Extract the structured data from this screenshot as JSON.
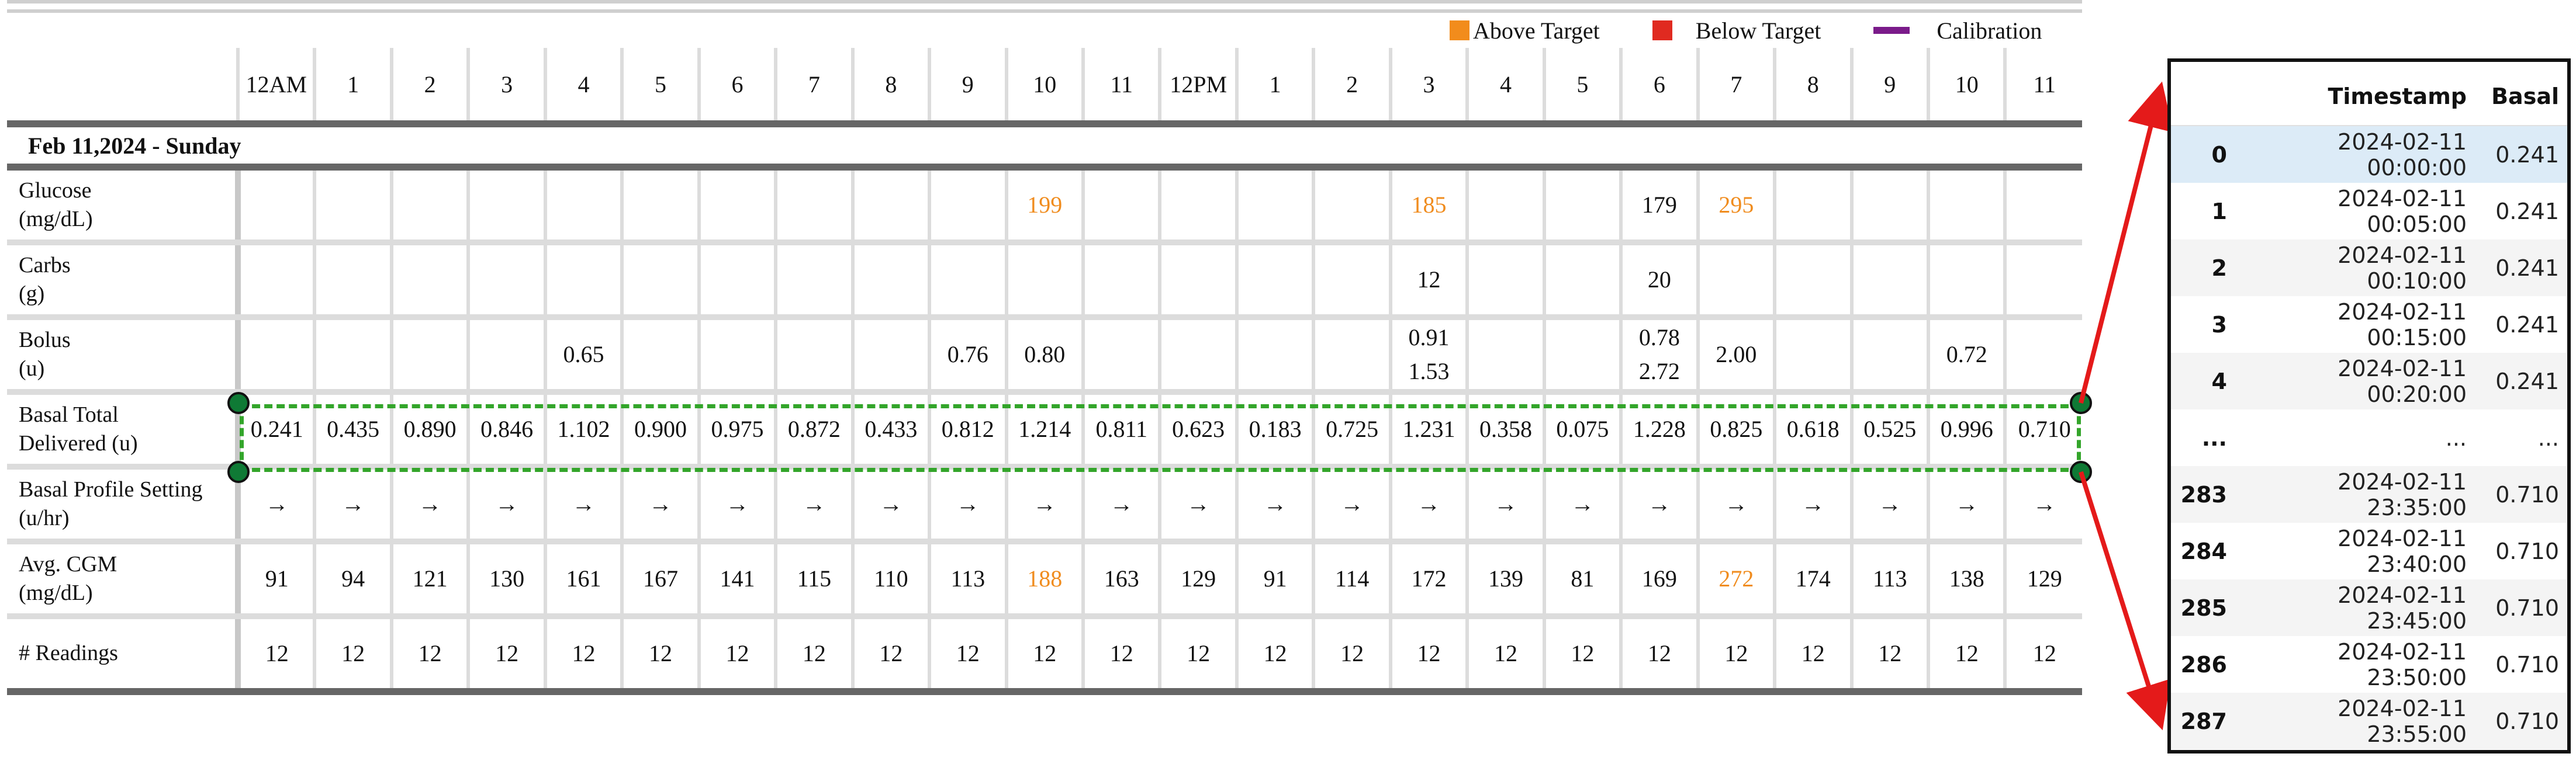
{
  "legend": [
    {
      "label": "Above Target",
      "color": "#f28c1c",
      "shape": "square"
    },
    {
      "label": "Below Target",
      "color": "#e02a20",
      "shape": "square"
    },
    {
      "label": "Calibration",
      "color": "#7b1b8a",
      "shape": "line"
    }
  ],
  "report": {
    "hours": [
      "12AM",
      "1",
      "2",
      "3",
      "4",
      "5",
      "6",
      "7",
      "8",
      "9",
      "10",
      "11",
      "12PM",
      "1",
      "2",
      "3",
      "4",
      "5",
      "6",
      "7",
      "8",
      "9",
      "10",
      "11"
    ],
    "date_label": "Feb 11,2024 - Sunday",
    "rows": [
      {
        "label": [
          "Glucose",
          "(mg/dL)"
        ],
        "cells": [
          "",
          "",
          "",
          "",
          "",
          "",
          "",
          "",
          "",
          "",
          "199",
          "",
          "",
          "",
          "",
          "185",
          "",
          "",
          "179",
          "295",
          "",
          "",
          "",
          ""
        ],
        "highlight": [
          10,
          15,
          19
        ]
      },
      {
        "label": [
          "Carbs",
          "(g)"
        ],
        "cells": [
          "",
          "",
          "",
          "",
          "",
          "",
          "",
          "",
          "",
          "",
          "",
          "",
          "",
          "",
          "",
          "12",
          "",
          "",
          "20",
          "",
          "",
          "",
          "",
          ""
        ]
      },
      {
        "label": [
          "Bolus",
          "(u)"
        ],
        "cells": [
          "",
          "",
          "",
          "",
          "0.65",
          "",
          "",
          "",
          "",
          "0.76",
          "0.80",
          "",
          "",
          "",
          "",
          "0.91\n1.53",
          "",
          "",
          "0.78\n2.72",
          "2.00",
          "",
          "",
          "0.72",
          ""
        ]
      },
      {
        "label": [
          "Basal Total",
          "Delivered (u)"
        ],
        "cells": [
          "0.241",
          "0.435",
          "0.890",
          "0.846",
          "1.102",
          "0.900",
          "0.975",
          "0.872",
          "0.433",
          "0.812",
          "1.214",
          "0.811",
          "0.623",
          "0.183",
          "0.725",
          "1.231",
          "0.358",
          "0.075",
          "1.228",
          "0.825",
          "0.618",
          "0.525",
          "0.996",
          "0.710"
        ]
      },
      {
        "label": [
          "Basal Profile Setting",
          "(u/hr)"
        ],
        "cells": [
          "→",
          "→",
          "→",
          "→",
          "→",
          "→",
          "→",
          "→",
          "→",
          "→",
          "→",
          "→",
          "→",
          "→",
          "→",
          "→",
          "→",
          "→",
          "→",
          "→",
          "→",
          "→",
          "→",
          "→"
        ]
      },
      {
        "label": [
          "Avg. CGM",
          "(mg/dL)"
        ],
        "cells": [
          "91",
          "94",
          "121",
          "130",
          "161",
          "167",
          "141",
          "115",
          "110",
          "113",
          "188",
          "163",
          "129",
          "91",
          "114",
          "172",
          "139",
          "81",
          "169",
          "272",
          "174",
          "113",
          "138",
          "129"
        ],
        "highlight": [
          10,
          19
        ]
      },
      {
        "label": [
          "# Readings"
        ],
        "cells": [
          "12",
          "12",
          "12",
          "12",
          "12",
          "12",
          "12",
          "12",
          "12",
          "12",
          "12",
          "12",
          "12",
          "12",
          "12",
          "12",
          "12",
          "12",
          "12",
          "12",
          "12",
          "12",
          "12",
          "12"
        ]
      }
    ]
  },
  "dataframe": {
    "columns": [
      "",
      "Timestamp",
      "Basal"
    ],
    "rows": [
      [
        "0",
        "2024-02-11 00:00:00",
        "0.241"
      ],
      [
        "1",
        "2024-02-11 00:05:00",
        "0.241"
      ],
      [
        "2",
        "2024-02-11 00:10:00",
        "0.241"
      ],
      [
        "3",
        "2024-02-11 00:15:00",
        "0.241"
      ],
      [
        "4",
        "2024-02-11 00:20:00",
        "0.241"
      ],
      [
        "...",
        "...",
        "..."
      ],
      [
        "283",
        "2024-02-11 23:35:00",
        "0.710"
      ],
      [
        "284",
        "2024-02-11 23:40:00",
        "0.710"
      ],
      [
        "285",
        "2024-02-11 23:45:00",
        "0.710"
      ],
      [
        "286",
        "2024-02-11 23:50:00",
        "0.710"
      ],
      [
        "287",
        "2024-02-11 23:55:00",
        "0.710"
      ]
    ],
    "selected_row": 0
  },
  "colors": {
    "above_target": "#f28c1c",
    "below_target": "#e02a20",
    "calibration": "#7b1b8a",
    "highlight_box": "#33a52a",
    "arrow": "#e41a1a"
  }
}
